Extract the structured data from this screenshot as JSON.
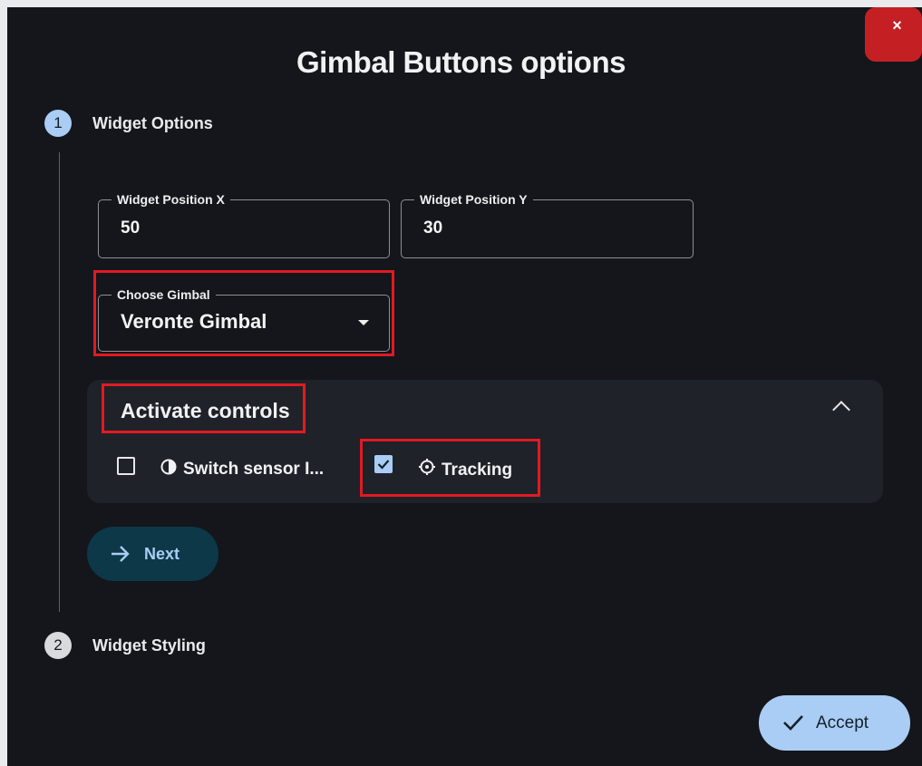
{
  "dialog": {
    "title": "Gimbal Buttons options",
    "close_label": "×"
  },
  "steps": [
    {
      "number": "1",
      "label": "Widget Options",
      "active": true
    },
    {
      "number": "2",
      "label": "Widget Styling",
      "active": false
    }
  ],
  "fields": {
    "position_x": {
      "label": "Widget Position X",
      "value": "50"
    },
    "position_y": {
      "label": "Widget Position Y",
      "value": "30"
    },
    "gimbal": {
      "label": "Choose Gimbal",
      "value": "Veronte Gimbal"
    }
  },
  "controls_panel": {
    "title": "Activate controls",
    "expanded": true,
    "items": [
      {
        "label": "Switch sensor I...",
        "icon": "contrast-icon",
        "checked": false
      },
      {
        "label": "Tracking",
        "icon": "crosshair-icon",
        "checked": true
      }
    ]
  },
  "buttons": {
    "next_label": "Next",
    "accept_label": "Accept"
  },
  "colors": {
    "background": "#14161b",
    "accent": "#a9cdf4",
    "close": "#c42024",
    "highlight": "#e11a22",
    "next_bg": "#0c3848"
  }
}
